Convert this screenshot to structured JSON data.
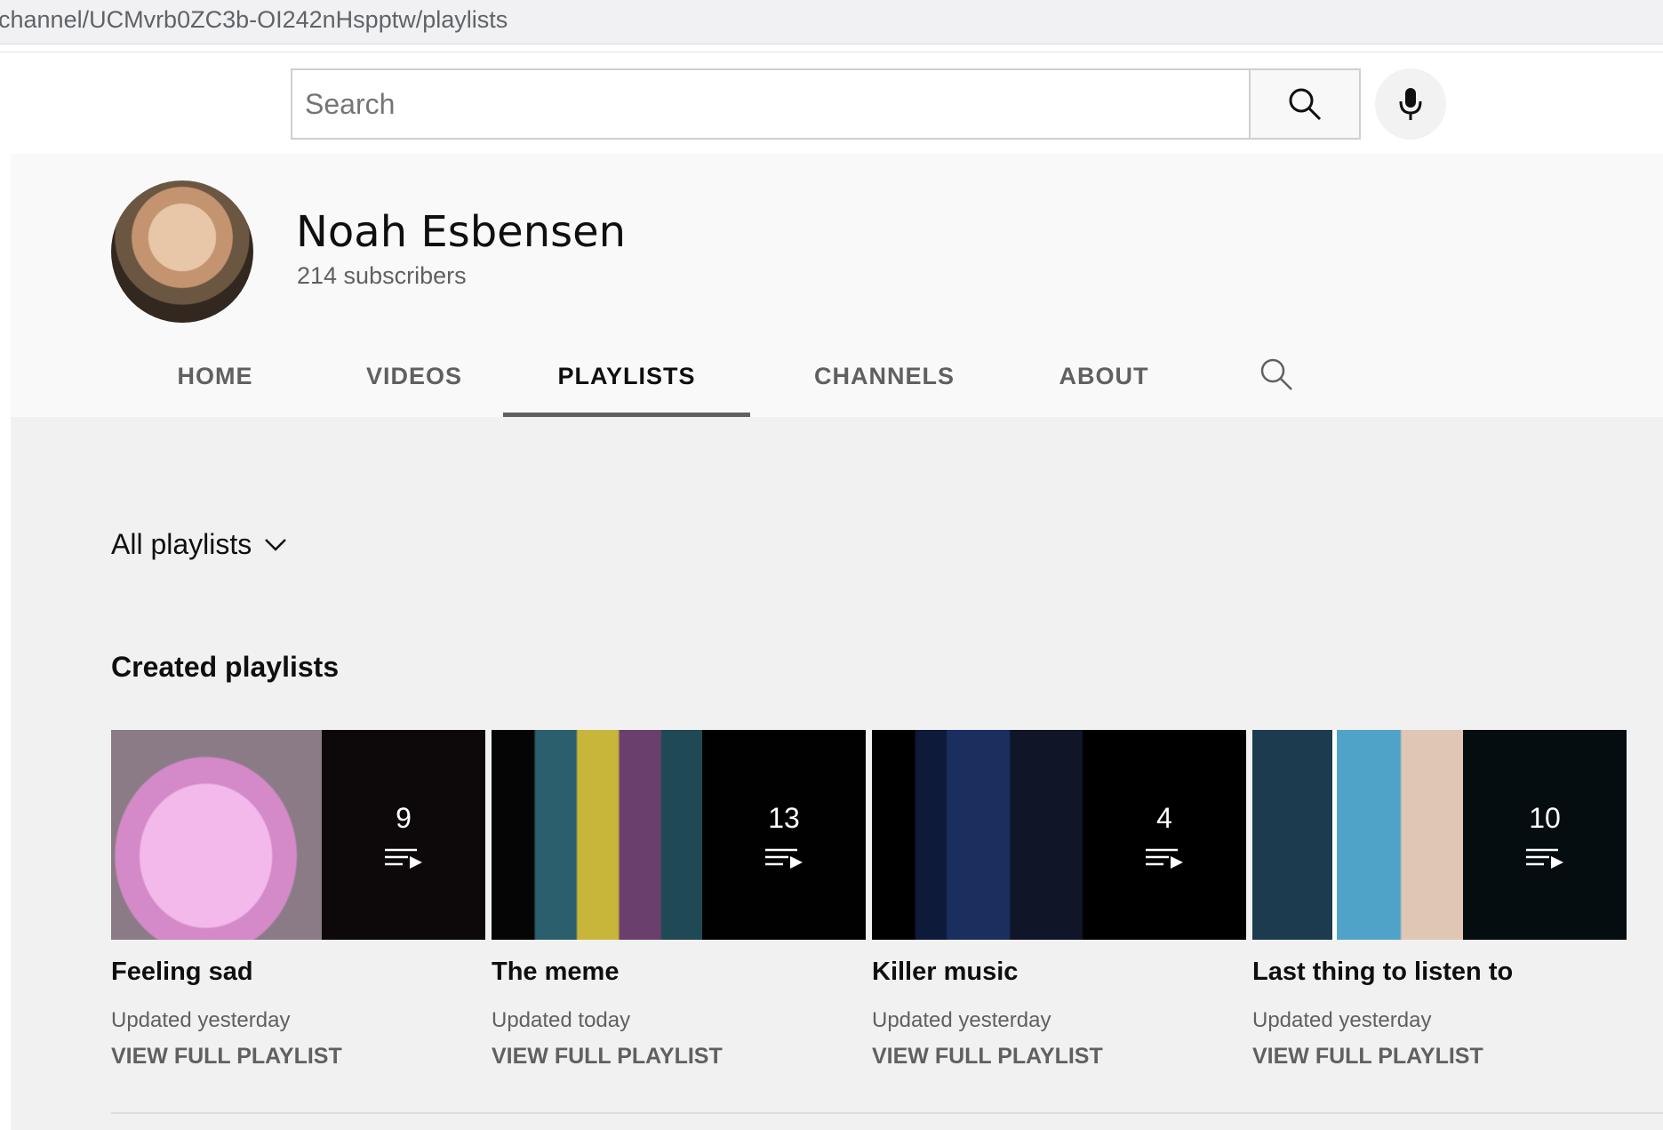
{
  "browser": {
    "url": "channel/UCMvrb0ZC3b-OI242nHspptw/playlists"
  },
  "search": {
    "placeholder": "Search"
  },
  "channel": {
    "name": "Noah Esbensen",
    "subscribers": "214 subscribers"
  },
  "tabs": [
    {
      "label": "HOME"
    },
    {
      "label": "VIDEOS"
    },
    {
      "label": "PLAYLISTS",
      "active": true
    },
    {
      "label": "CHANNELS"
    },
    {
      "label": "ABOUT"
    }
  ],
  "filter": {
    "label": "All playlists"
  },
  "section": {
    "title": "Created playlists"
  },
  "playlists": [
    {
      "title": "Feeling sad",
      "count": "9",
      "updated": "Updated yesterday",
      "view": "VIEW FULL PLAYLIST"
    },
    {
      "title": "The meme",
      "count": "13",
      "updated": "Updated today",
      "view": "VIEW FULL PLAYLIST"
    },
    {
      "title": "Killer music",
      "count": "4",
      "updated": "Updated yesterday",
      "view": "VIEW FULL PLAYLIST"
    },
    {
      "title": "Last thing to listen to",
      "count": "10",
      "updated": "Updated yesterday",
      "view": "VIEW FULL PLAYLIST"
    }
  ],
  "icons": {
    "search": "search-icon",
    "mic": "microphone-icon",
    "tab_search": "search-icon",
    "dropdown": "chevron-down-icon",
    "playlist": "playlist-play-icon"
  },
  "colors": {
    "active_tab_underline": "#606060",
    "content_bg": "#f1f1f1",
    "header_bg": "#f9f9f9"
  }
}
